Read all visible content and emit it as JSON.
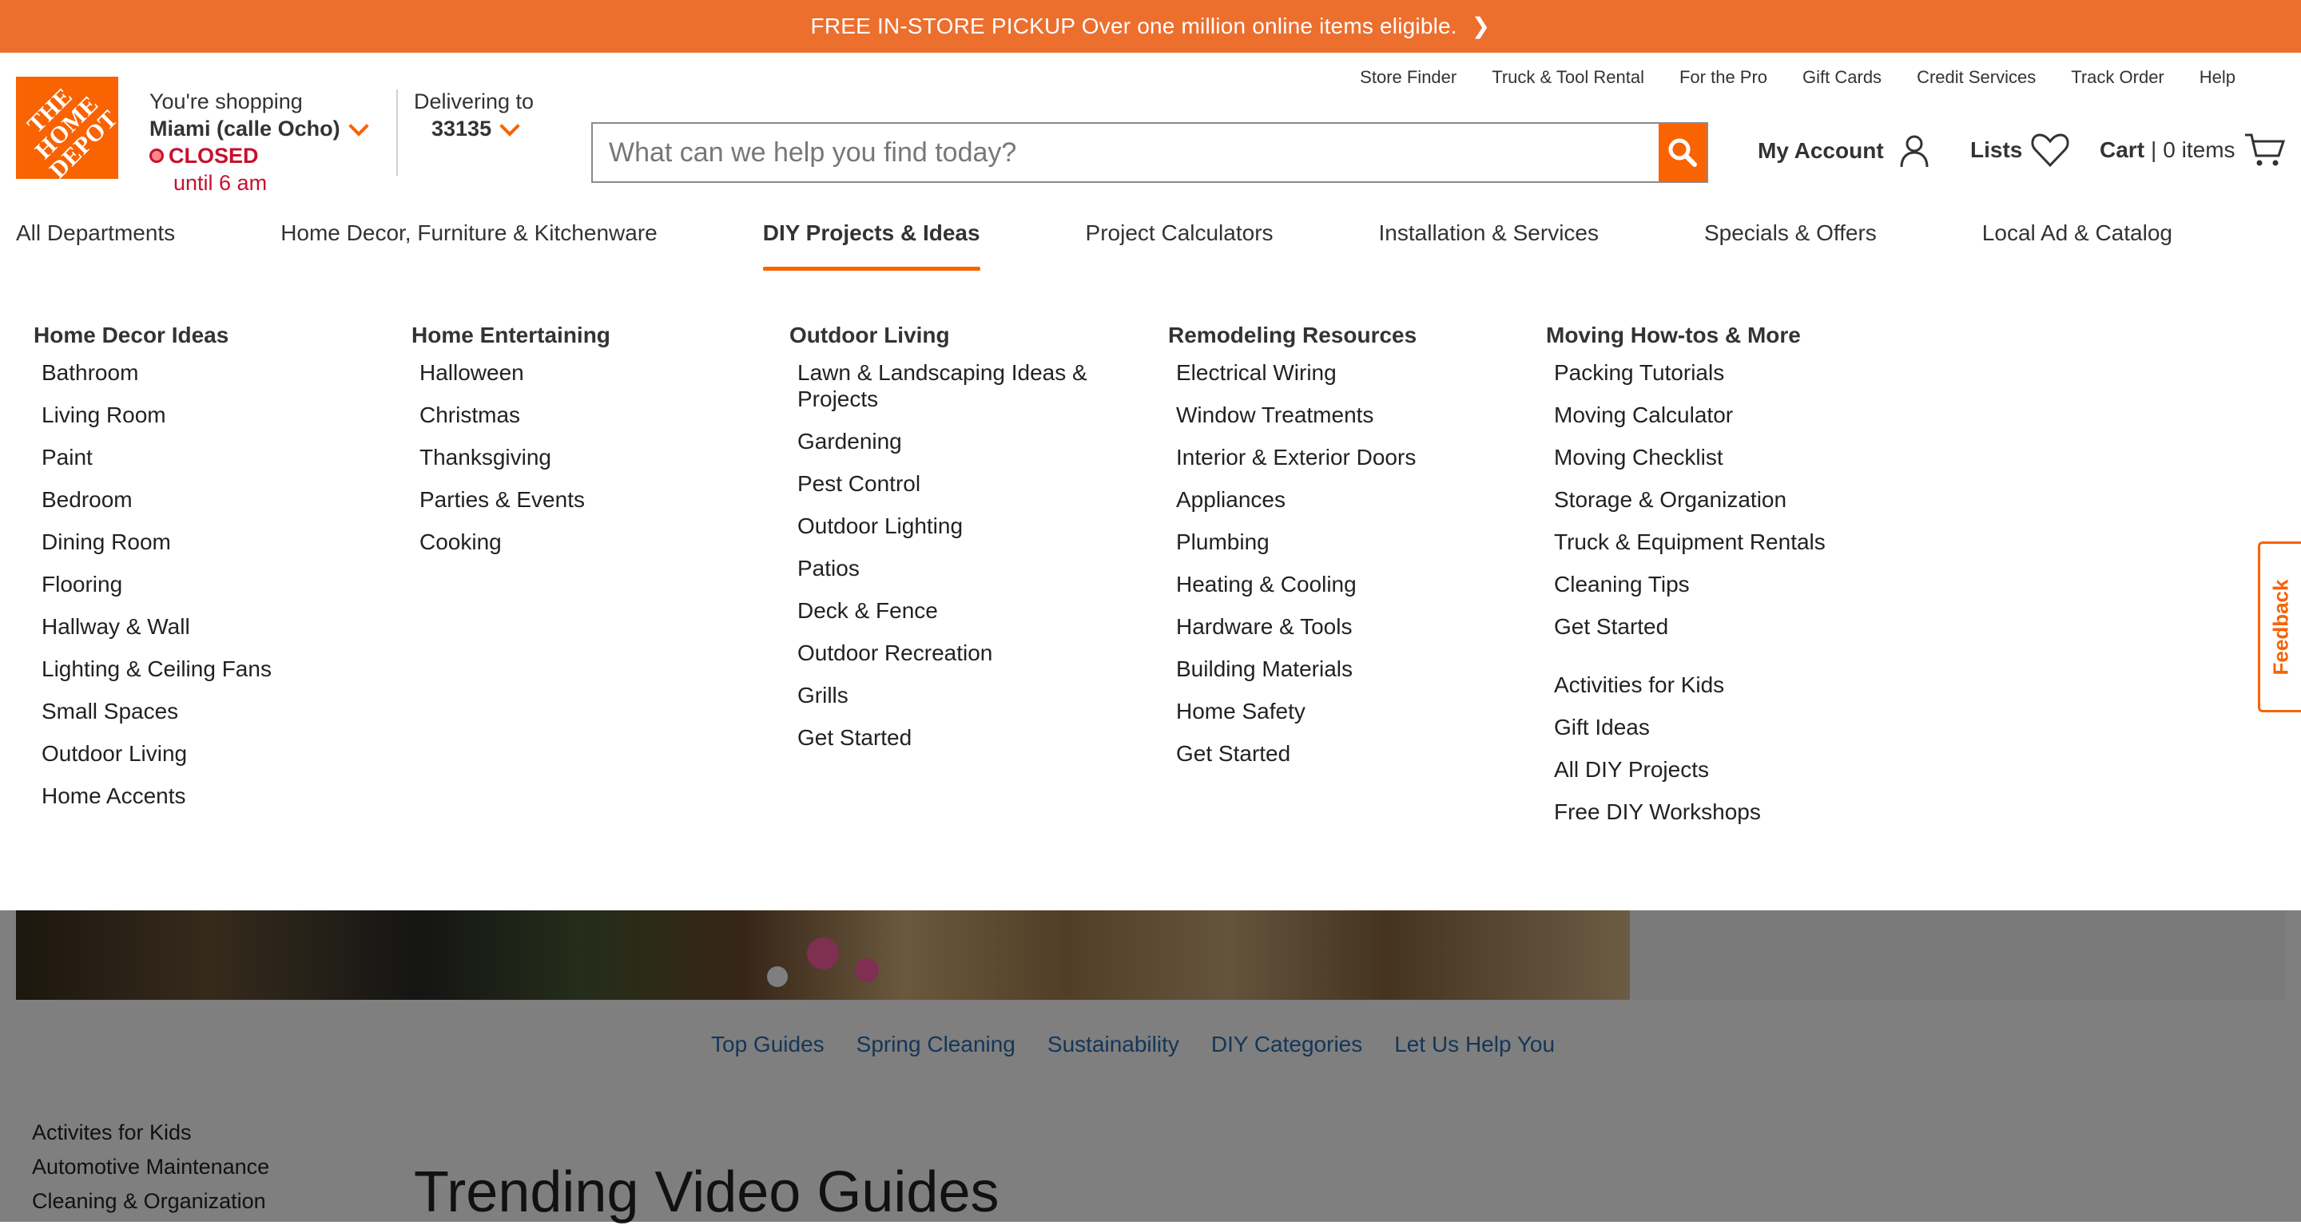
{
  "promo": {
    "text": "FREE IN-STORE PICKUP Over one million online items eligible."
  },
  "logo": {
    "text": "THE HOME DEPOT"
  },
  "store": {
    "label": "You're shopping",
    "name": "Miami (calle Ocho)",
    "status": "CLOSED",
    "until": "until 6 am"
  },
  "delivery": {
    "label": "Delivering to",
    "zip": "33135"
  },
  "utility_links": [
    "Store Finder",
    "Truck & Tool Rental",
    "For the Pro",
    "Gift Cards",
    "Credit Services",
    "Track Order",
    "Help"
  ],
  "search": {
    "placeholder": "What can we help you find today?"
  },
  "account": {
    "label": "My Account"
  },
  "lists": {
    "label": "Lists"
  },
  "cart": {
    "label": "Cart",
    "separator": "|",
    "items": "0 items"
  },
  "nav": [
    "All Departments",
    "Home Decor, Furniture & Kitchenware",
    "DIY Projects & Ideas",
    "Project Calculators",
    "Installation & Services",
    "Specials & Offers",
    "Local Ad & Catalog"
  ],
  "mega_menu": {
    "columns": [
      {
        "title": "Home Decor Ideas",
        "items": [
          "Bathroom",
          "Living Room",
          "Paint",
          "Bedroom",
          "Dining Room",
          "Flooring",
          "Hallway & Wall",
          "Lighting & Ceiling Fans",
          "Small Spaces",
          "Outdoor Living",
          "Home Accents"
        ]
      },
      {
        "title": "Home Entertaining",
        "items": [
          "Halloween",
          "Christmas",
          "Thanksgiving",
          "Parties & Events",
          "Cooking"
        ]
      },
      {
        "title": "Outdoor Living",
        "items": [
          "Lawn & Landscaping Ideas & Projects",
          "Gardening",
          "Pest Control",
          "Outdoor Lighting",
          "Patios",
          "Deck & Fence",
          "Outdoor Recreation",
          "Grills",
          "Get Started"
        ]
      },
      {
        "title": "Remodeling Resources",
        "items": [
          "Electrical Wiring",
          "Window Treatments",
          "Interior & Exterior Doors",
          "Appliances",
          "Plumbing",
          "Heating & Cooling",
          "Hardware & Tools",
          "Building Materials",
          "Home Safety",
          "Get Started"
        ]
      },
      {
        "title": "Moving How-tos & More",
        "items": [
          "Packing Tutorials",
          "Moving Calculator",
          "Moving Checklist",
          "Storage & Organization",
          "Truck & Equipment Rentals",
          "Cleaning Tips",
          "Get Started"
        ],
        "extra_items": [
          "Activities for Kids",
          "Gift Ideas",
          "All DIY Projects",
          "Free DIY Workshops"
        ]
      }
    ]
  },
  "subnav": [
    "Top Guides",
    "Spring Cleaning",
    "Sustainability",
    "DIY Categories",
    "Let Us Help You"
  ],
  "side_list": [
    "Activites for Kids",
    "Automotive Maintenance",
    "Cleaning & Organization"
  ],
  "trending_title": "Trending Video Guides",
  "feedback": {
    "label": "Feedback"
  },
  "colors": {
    "brand_orange": "#f96302",
    "promo_orange": "#ec6f2e",
    "closed_red": "#c8102e"
  }
}
